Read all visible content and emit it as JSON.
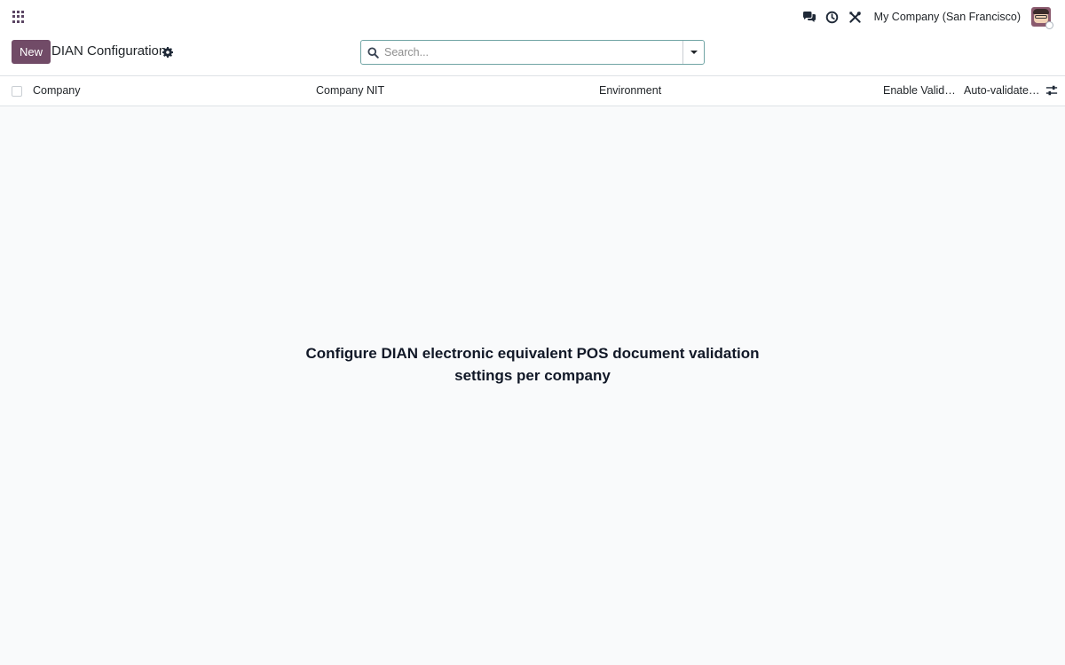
{
  "navbar": {
    "apps_icon": "grid-icon",
    "systray": [
      {
        "name": "discuss",
        "icon": "chat-bubbles-icon"
      },
      {
        "name": "activities",
        "icon": "clock-icon"
      },
      {
        "name": "debug",
        "icon": "tools-icon"
      }
    ],
    "company": "My Company (San Francisco)",
    "avatar_icon": "user-avatar"
  },
  "control_panel": {
    "new_label": "New",
    "title": "DIAN Configuration",
    "settings_icon": "gear-icon",
    "search": {
      "placeholder": "Search...",
      "value": ""
    }
  },
  "list": {
    "columns": [
      "Company",
      "Company NIT",
      "Environment",
      "Enable Valida...",
      "Auto-validate ..."
    ],
    "optional_columns_icon": "sliders-icon",
    "rows": []
  },
  "empty_state": {
    "line1": "Configure DIAN electronic equivalent POS document validation",
    "line2": "settings per company"
  },
  "colors": {
    "primary": "#714b67",
    "search_border": "#71a5a5",
    "background": "#f9fafb"
  }
}
